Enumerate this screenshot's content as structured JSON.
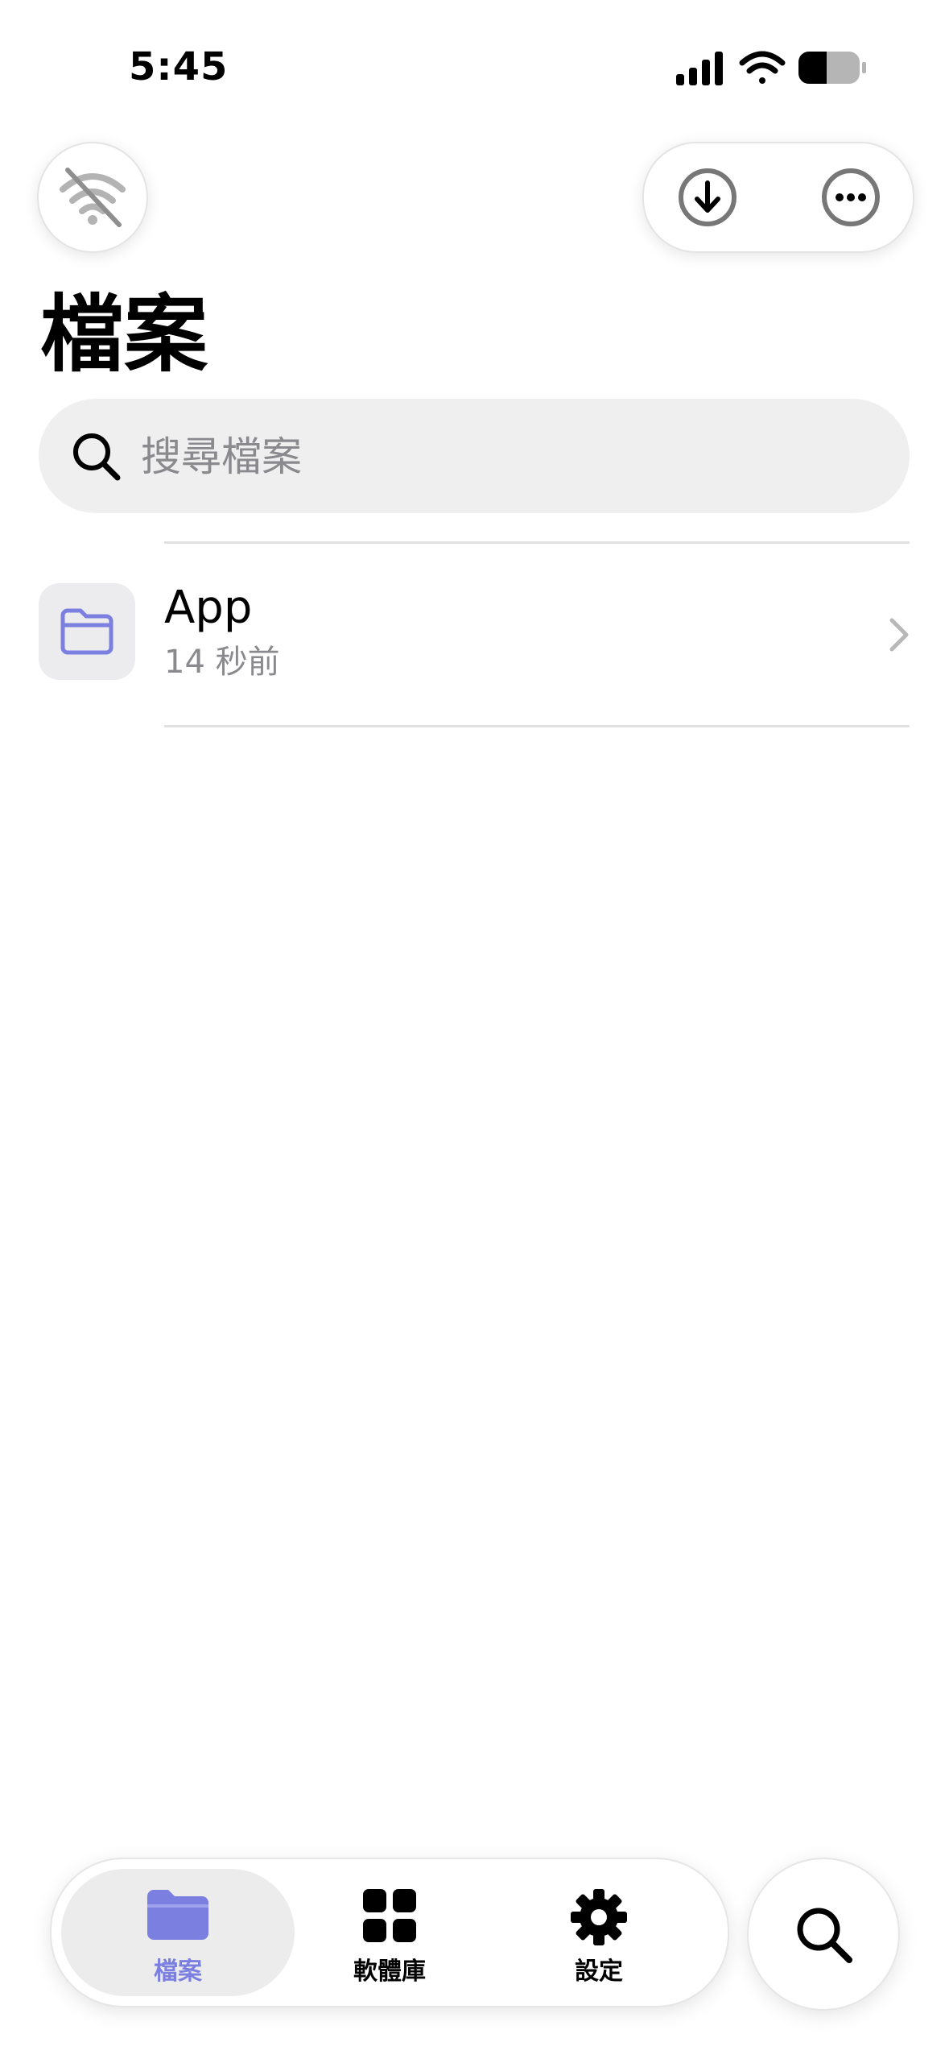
{
  "status_bar": {
    "time": "5:45"
  },
  "header": {
    "title": "檔案",
    "wifi_icon": "wifi-off-icon",
    "download_icon": "download-icon",
    "more_icon": "more-icon"
  },
  "search": {
    "placeholder": "搜尋檔案",
    "value": ""
  },
  "files": [
    {
      "name": "App",
      "modified": "14 秒前",
      "icon": "folder-icon"
    }
  ],
  "tab_bar": {
    "tabs": [
      {
        "label": "檔案",
        "icon": "folder-icon",
        "active": true
      },
      {
        "label": "軟體庫",
        "icon": "grid-icon",
        "active": false
      },
      {
        "label": "設定",
        "icon": "gear-icon",
        "active": false
      }
    ],
    "search_icon": "search-icon"
  },
  "colors": {
    "accent": "#7b7fe0",
    "secondary_text": "#8a8a8e",
    "search_bg": "#efefef"
  }
}
